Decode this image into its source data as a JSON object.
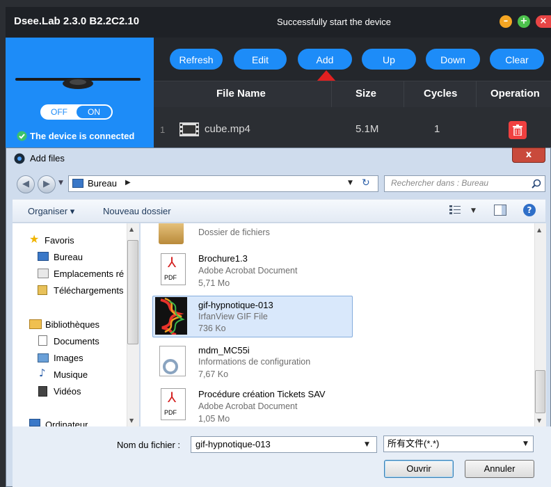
{
  "app": {
    "title": "Dsee.Lab 2.3.0 B2.2C2.10",
    "status": "Successfully start the device",
    "toggle_off": "OFF",
    "toggle_on": "ON",
    "connection_status": "The device is connected",
    "toolbar": [
      "Refresh",
      "Edit",
      "Add",
      "Up",
      "Down",
      "Clear"
    ],
    "columns": [
      "File Name",
      "Size",
      "Cycles",
      "Operation"
    ],
    "rows": [
      {
        "index": "1",
        "name": "cube.mp4",
        "size": "5.1M",
        "cycles": "1"
      }
    ],
    "colors": {
      "accent": "#1d8cf8",
      "delete": "#f04040",
      "arrow": "#e02020"
    }
  },
  "dialog": {
    "title": "Add files",
    "address": "Bureau",
    "search_placeholder": "Rechercher dans : Bureau",
    "commands": {
      "organize": "Organiser ▾",
      "new_folder": "Nouveau dossier"
    },
    "nav": {
      "favorites": "Favoris",
      "fav_items": [
        "Bureau",
        "Emplacements ré",
        "Téléchargements"
      ],
      "libraries": "Bibliothèques",
      "lib_items": [
        "Documents",
        "Images",
        "Musique",
        "Vidéos"
      ],
      "computer": "Ordinateur"
    },
    "files": [
      {
        "name": "",
        "type": "Dossier de fichiers",
        "size": ""
      },
      {
        "name": "Brochure1.3",
        "type": "Adobe Acrobat Document",
        "size": "5,71 Mo"
      },
      {
        "name": "gif-hypnotique-013",
        "type": "IrfanView GIF File",
        "size": "736 Ko"
      },
      {
        "name": "mdm_MC55i",
        "type": "Informations de configuration",
        "size": "7,67 Ko"
      },
      {
        "name": "Procédure création Tickets SAV",
        "type": "Adobe Acrobat Document",
        "size": "1,05 Mo"
      }
    ],
    "pdf_label": "PDF",
    "filename_label": "Nom du fichier :",
    "filename_value": "gif-hypnotique-013",
    "filetype_value": "所有文件(*.*)",
    "open_button": "Ouvrir",
    "cancel_button": "Annuler"
  }
}
